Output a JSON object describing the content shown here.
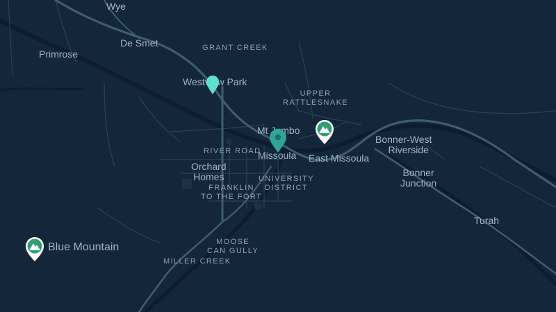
{
  "map": {
    "colors": {
      "background": "#13263a",
      "water": "#0e1d2d",
      "road": "#3e5c73",
      "highway": "#4d7189",
      "label": "#a2b6c6",
      "pin_teal": "#2ea597",
      "pin_selected": "#5fe0cc",
      "peak_marker": "#2f9e70"
    },
    "towns": {
      "wye": "Wye",
      "de_smet": "De Smet",
      "primrose": "Primrose",
      "westview_park": "Westview Park",
      "mt_jumbo": "Mt Jumbo",
      "missoula": "Missoula",
      "east_missoula": "East Missoula",
      "bonner_west_riverside_1": "Bonner-West",
      "bonner_west_riverside_2": "Riverside",
      "bonner_junction_1": "Bonner",
      "bonner_junction_2": "Junction",
      "orchard_homes_1": "Orchard",
      "orchard_homes_2": "Homes",
      "turah": "Turah"
    },
    "neighborhoods": {
      "grant_creek": "GRANT CREEK",
      "upper_rattlesnake_1": "UPPER",
      "upper_rattlesnake_2": "RATTLESNAKE",
      "river_road": "RIVER ROAD",
      "university_district_1": "UNIVERSITY",
      "university_district_2": "DISTRICT",
      "franklin_to_the_fort_1": "FRANKLIN",
      "franklin_to_the_fort_2": "TO THE FORT",
      "moose_can_gully_1": "MOOSE",
      "moose_can_gully_2": "CAN GULLY",
      "miller_creek": "MILLER CREEK"
    },
    "peaks": {
      "blue_mountain": "Blue Mountain",
      "peak_icon": "mountain-icon"
    }
  }
}
